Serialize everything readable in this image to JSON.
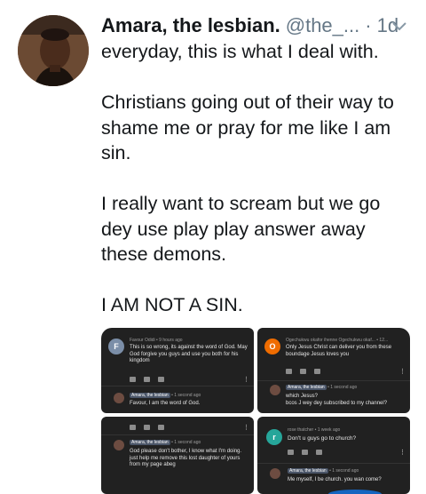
{
  "tweet": {
    "display_name": "Amara, the lesbian.",
    "handle": "@the_...",
    "separator": "·",
    "time": "1d",
    "text": "everyday, this is what I deal with.\n\nChristians going out of their way to shame me or pray for me like I am sin.\n\nI really want to scream but we go dey use play play answer away these demons.\n\nI AM NOT A SIN."
  },
  "media": {
    "s1": {
      "author_initial": "F",
      "meta": "Favour Odidi • 9 hours ago",
      "comment": "This is so wrong, its against the word of God. May God forgive you guys and use you both for his kingdom",
      "reply_badge": "Amara, the lesbian",
      "reply_meta": "• 1 second ago",
      "reply": "Favour, I am the word of God."
    },
    "s2": {
      "author_initial": "O",
      "meta": "Ogechukwu okafor ihenne Ogechukwu okaf... • 12...",
      "comment": "Only Jesus Christ can deliver you from these boundage Jesus loves you",
      "reply_badge": "Amara, the lesbian",
      "reply_meta": "• 1 second ago",
      "reply": "which Jesus?\nbcos J wey dey subscribed to my channel?"
    },
    "s3": {
      "reply_badge": "Amara, the lesbian",
      "reply_meta": "• 1 second ago",
      "reply": "God please don't bother, I know what I'm doing.\njust help me remove this lost daughter of yours from my page abeg"
    },
    "s4": {
      "author_initial": "r",
      "meta": "rose thatcher • 1 week ago",
      "comment": "Don't u guys go to church?",
      "reply_badge": "Amara, the lesbian",
      "reply_meta": "• 1 second ago",
      "reply": "Me myself, I be church. you wan come?"
    }
  },
  "colors": {
    "s1_avatar": "#7b8ea8",
    "s2_avatar": "#ef6c00",
    "s4_avatar": "#26a69a"
  },
  "icons": [
    "chevron-down-icon",
    "like-icon",
    "dislike-icon",
    "reply-icon",
    "more-vert-icon"
  ]
}
